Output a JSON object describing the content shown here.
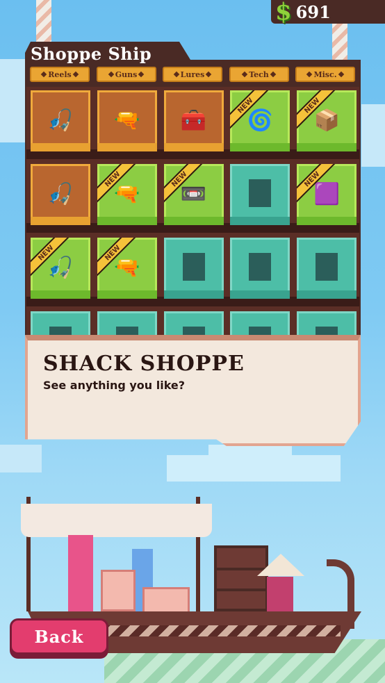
{
  "currency": {
    "symbol": "$",
    "amount": "691"
  },
  "shop": {
    "title": "Shoppe Ship",
    "tabs": [
      {
        "label": "Reels"
      },
      {
        "label": "Guns"
      },
      {
        "label": "Lures"
      },
      {
        "label": "Tech"
      },
      {
        "label": "Misc."
      }
    ],
    "items": [
      {
        "state": "owned",
        "icon": "reel-icon",
        "glyph": "🎣",
        "new": false
      },
      {
        "state": "owned",
        "icon": "gun-icon",
        "glyph": "🔫",
        "new": false
      },
      {
        "state": "owned",
        "icon": "lure-icon",
        "glyph": "🧰",
        "new": false
      },
      {
        "state": "new",
        "icon": "spring-icon",
        "glyph": "🌀",
        "new": true
      },
      {
        "state": "new",
        "icon": "red-gadget-icon",
        "glyph": "📦",
        "new": true
      },
      {
        "state": "owned",
        "icon": "reel-icon",
        "glyph": "🎣",
        "new": false
      },
      {
        "state": "new",
        "icon": "rifle-icon",
        "glyph": "🔫",
        "new": true
      },
      {
        "state": "new",
        "icon": "box-lure-icon",
        "glyph": "📼",
        "new": true
      },
      {
        "state": "locked",
        "icon": "spider-icon",
        "glyph": "✳",
        "new": false
      },
      {
        "state": "new",
        "icon": "crate-icon",
        "glyph": "🟪",
        "new": true
      },
      {
        "state": "new",
        "icon": "reel-icon",
        "glyph": "🎣",
        "new": true
      },
      {
        "state": "new",
        "icon": "pistol-icon",
        "glyph": "🔫",
        "new": true
      },
      {
        "state": "locked",
        "icon": "canister-icon",
        "glyph": "",
        "new": false
      },
      {
        "state": "locked",
        "icon": "jar-icon",
        "glyph": "",
        "new": false
      },
      {
        "state": "locked",
        "icon": "bottle-icon",
        "glyph": "",
        "new": false
      },
      {
        "state": "locked",
        "icon": "locked-icon",
        "glyph": "",
        "new": false
      },
      {
        "state": "locked",
        "icon": "locked-icon",
        "glyph": "",
        "new": false
      },
      {
        "state": "locked",
        "icon": "locked-icon",
        "glyph": "",
        "new": false
      },
      {
        "state": "locked",
        "icon": "locked-icon",
        "glyph": "",
        "new": false
      },
      {
        "state": "locked",
        "icon": "locked-icon",
        "glyph": "",
        "new": false
      }
    ],
    "new_label": "NEW"
  },
  "dialog": {
    "title": "SHACK SHOPPE",
    "subtitle": "See anything you like?"
  },
  "back_button": {
    "label": "Back"
  }
}
